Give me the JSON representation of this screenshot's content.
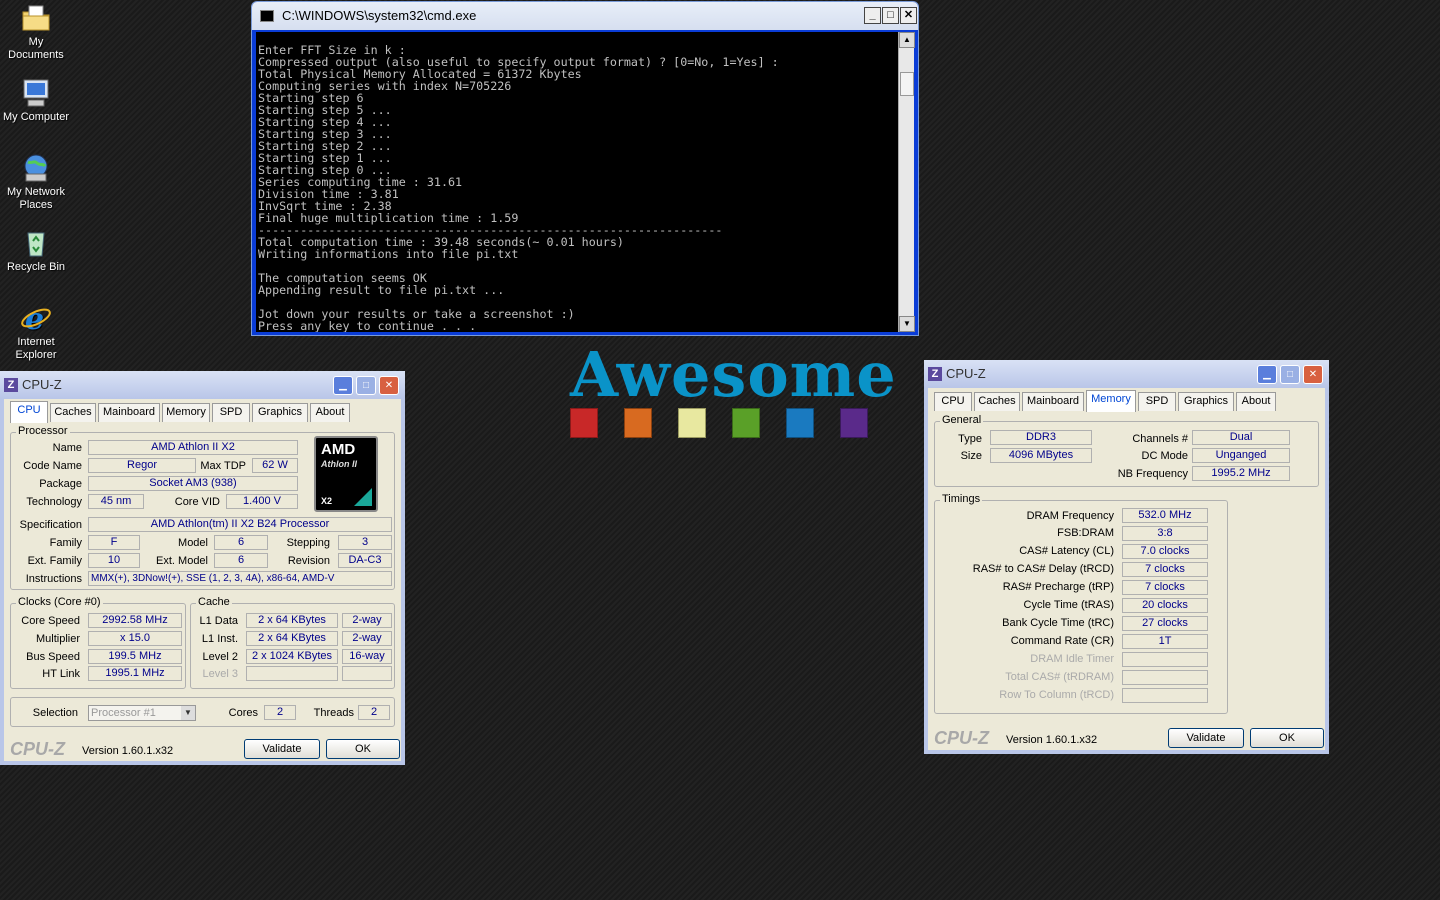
{
  "desktop": {
    "icons": [
      {
        "label": "My Documents",
        "icon": "folder-documents-icon"
      },
      {
        "label": "My Computer",
        "icon": "computer-icon"
      },
      {
        "label": "My Network Places",
        "icon": "network-icon"
      },
      {
        "label": "Recycle Bin",
        "icon": "recycle-bin-icon"
      },
      {
        "label": "Internet Explorer",
        "icon": "internet-explorer-icon"
      }
    ],
    "wallpaper_text": "Awesome",
    "squares": [
      "#c82828",
      "#d86a20",
      "#e8e8a0",
      "#5aa028",
      "#1a7ac0",
      "#5a2a8a"
    ]
  },
  "cmd": {
    "title": "C:\\WINDOWS\\system32\\cmd.exe",
    "output": "Enter FFT Size in k :\nCompressed output (also useful to specify output format) ? [0=No, 1=Yes] :\nTotal Physical Memory Allocated = 61372 Kbytes\nComputing series with index N=705226\nStarting step 6\nStarting step 5 ...\nStarting step 4 ...\nStarting step 3 ...\nStarting step 2 ...\nStarting step 1 ...\nStarting step 0 ...\nSeries computing time : 31.61\nDivision time : 3.81\nInvSqrt time : 2.38\nFinal huge multiplication time : 1.59\n------------------------------------------------------------------\nTotal computation time : 39.48 seconds(~ 0.01 hours)\nWriting informations into file pi.txt\n\nThe computation seems OK\nAppending result to file pi.txt ...\n\nJot down your results or take a screenshot :)\nPress any key to continue . . . _"
  },
  "cpuz_left": {
    "title": "CPU-Z",
    "tabs": [
      "CPU",
      "Caches",
      "Mainboard",
      "Memory",
      "SPD",
      "Graphics",
      "About"
    ],
    "processor_group": "Processor",
    "name_label": "Name",
    "name": "AMD Athlon II X2",
    "codename_label": "Code Name",
    "codename": "Regor",
    "maxtdp_label": "Max TDP",
    "maxtdp": "62 W",
    "package_label": "Package",
    "package": "Socket AM3 (938)",
    "technology_label": "Technology",
    "technology": "45 nm",
    "corevid_label": "Core VID",
    "corevid": "1.400 V",
    "spec_label": "Specification",
    "spec": "AMD Athlon(tm) II X2 B24 Processor",
    "family_label": "Family",
    "family": "F",
    "model_label": "Model",
    "model": "6",
    "stepping_label": "Stepping",
    "stepping": "3",
    "extfamily_label": "Ext. Family",
    "extfamily": "10",
    "extmodel_label": "Ext. Model",
    "extmodel": "6",
    "revision_label": "Revision",
    "revision": "DA-C3",
    "instructions_label": "Instructions",
    "instructions": "MMX(+), 3DNow!(+), SSE (1, 2, 3, 4A), x86-64, AMD-V",
    "logo_amd": "AMD",
    "logo_line": "Athlon II",
    "logo_x2": "X2",
    "clocks_group": "Clocks (Core #0)",
    "corespeed_label": "Core Speed",
    "corespeed": "2992.58 MHz",
    "multiplier_label": "Multiplier",
    "multiplier": "x 15.0",
    "busspeed_label": "Bus Speed",
    "busspeed": "199.5 MHz",
    "htlink_label": "HT Link",
    "htlink": "1995.1 MHz",
    "cache_group": "Cache",
    "l1d_label": "L1 Data",
    "l1d": "2 x 64 KBytes",
    "l1d_way": "2-way",
    "l1i_label": "L1 Inst.",
    "l1i": "2 x 64 KBytes",
    "l1i_way": "2-way",
    "l2_label": "Level 2",
    "l2": "2 x 1024 KBytes",
    "l2_way": "16-way",
    "l3_label": "Level 3",
    "selection_label": "Selection",
    "selection": "Processor #1",
    "cores_label": "Cores",
    "cores": "2",
    "threads_label": "Threads",
    "threads": "2",
    "brand": "CPU-Z",
    "version": "Version 1.60.1.x32",
    "validate": "Validate",
    "ok": "OK"
  },
  "cpuz_right": {
    "title": "CPU-Z",
    "tabs": [
      "CPU",
      "Caches",
      "Mainboard",
      "Memory",
      "SPD",
      "Graphics",
      "About"
    ],
    "general_group": "General",
    "type_label": "Type",
    "type": "DDR3",
    "size_label": "Size",
    "size": "4096 MBytes",
    "channels_label": "Channels #",
    "channels": "Dual",
    "dcmode_label": "DC Mode",
    "dcmode": "Unganged",
    "nbfreq_label": "NB Frequency",
    "nbfreq": "1995.2 MHz",
    "timings_group": "Timings",
    "timings": [
      {
        "label": "DRAM Frequency",
        "value": "532.0 MHz",
        "dim": false
      },
      {
        "label": "FSB:DRAM",
        "value": "3:8",
        "dim": false
      },
      {
        "label": "CAS# Latency (CL)",
        "value": "7.0 clocks",
        "dim": false
      },
      {
        "label": "RAS# to CAS# Delay (tRCD)",
        "value": "7 clocks",
        "dim": false
      },
      {
        "label": "RAS# Precharge (tRP)",
        "value": "7 clocks",
        "dim": false
      },
      {
        "label": "Cycle Time (tRAS)",
        "value": "20 clocks",
        "dim": false
      },
      {
        "label": "Bank Cycle Time (tRC)",
        "value": "27 clocks",
        "dim": false
      },
      {
        "label": "Command Rate (CR)",
        "value": "1T",
        "dim": false
      },
      {
        "label": "DRAM Idle Timer",
        "value": "",
        "dim": true
      },
      {
        "label": "Total CAS# (tRDRAM)",
        "value": "",
        "dim": true
      },
      {
        "label": "Row To Column (tRCD)",
        "value": "",
        "dim": true
      }
    ],
    "brand": "CPU-Z",
    "version": "Version 1.60.1.x32",
    "validate": "Validate",
    "ok": "OK"
  }
}
